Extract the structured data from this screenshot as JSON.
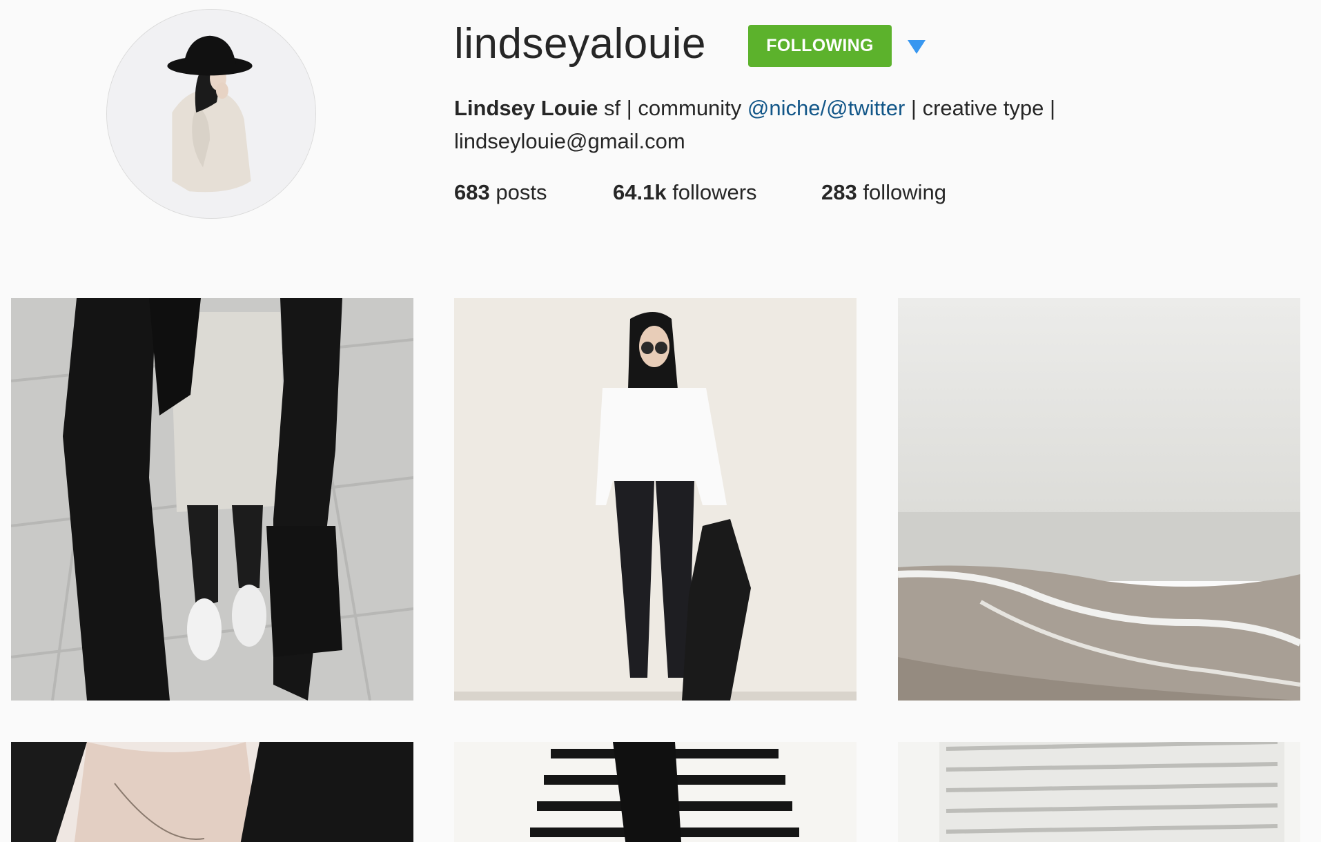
{
  "profile": {
    "username": "lindseyalouie",
    "follow_button_label": "FOLLOWING",
    "bio": {
      "full_name": "Lindsey Louie",
      "text_before_mentions": " sf | community ",
      "mention_1": "@niche",
      "separator": "/",
      "mention_2": "@twitter",
      "text_after_mentions": " | creative type |",
      "email": "lindseylouie@gmail.com"
    },
    "stats": {
      "posts_count": "683",
      "posts_label": " posts",
      "followers_count": "64.1k",
      "followers_label": " followers",
      "following_count": "283",
      "following_label": " following"
    }
  },
  "colors": {
    "background": "#fafafa",
    "follow_button": "#5cb22c",
    "dropdown_arrow": "#3897f0",
    "mention_link": "#125688"
  },
  "icons": {
    "dropdown": "triangle-down"
  }
}
